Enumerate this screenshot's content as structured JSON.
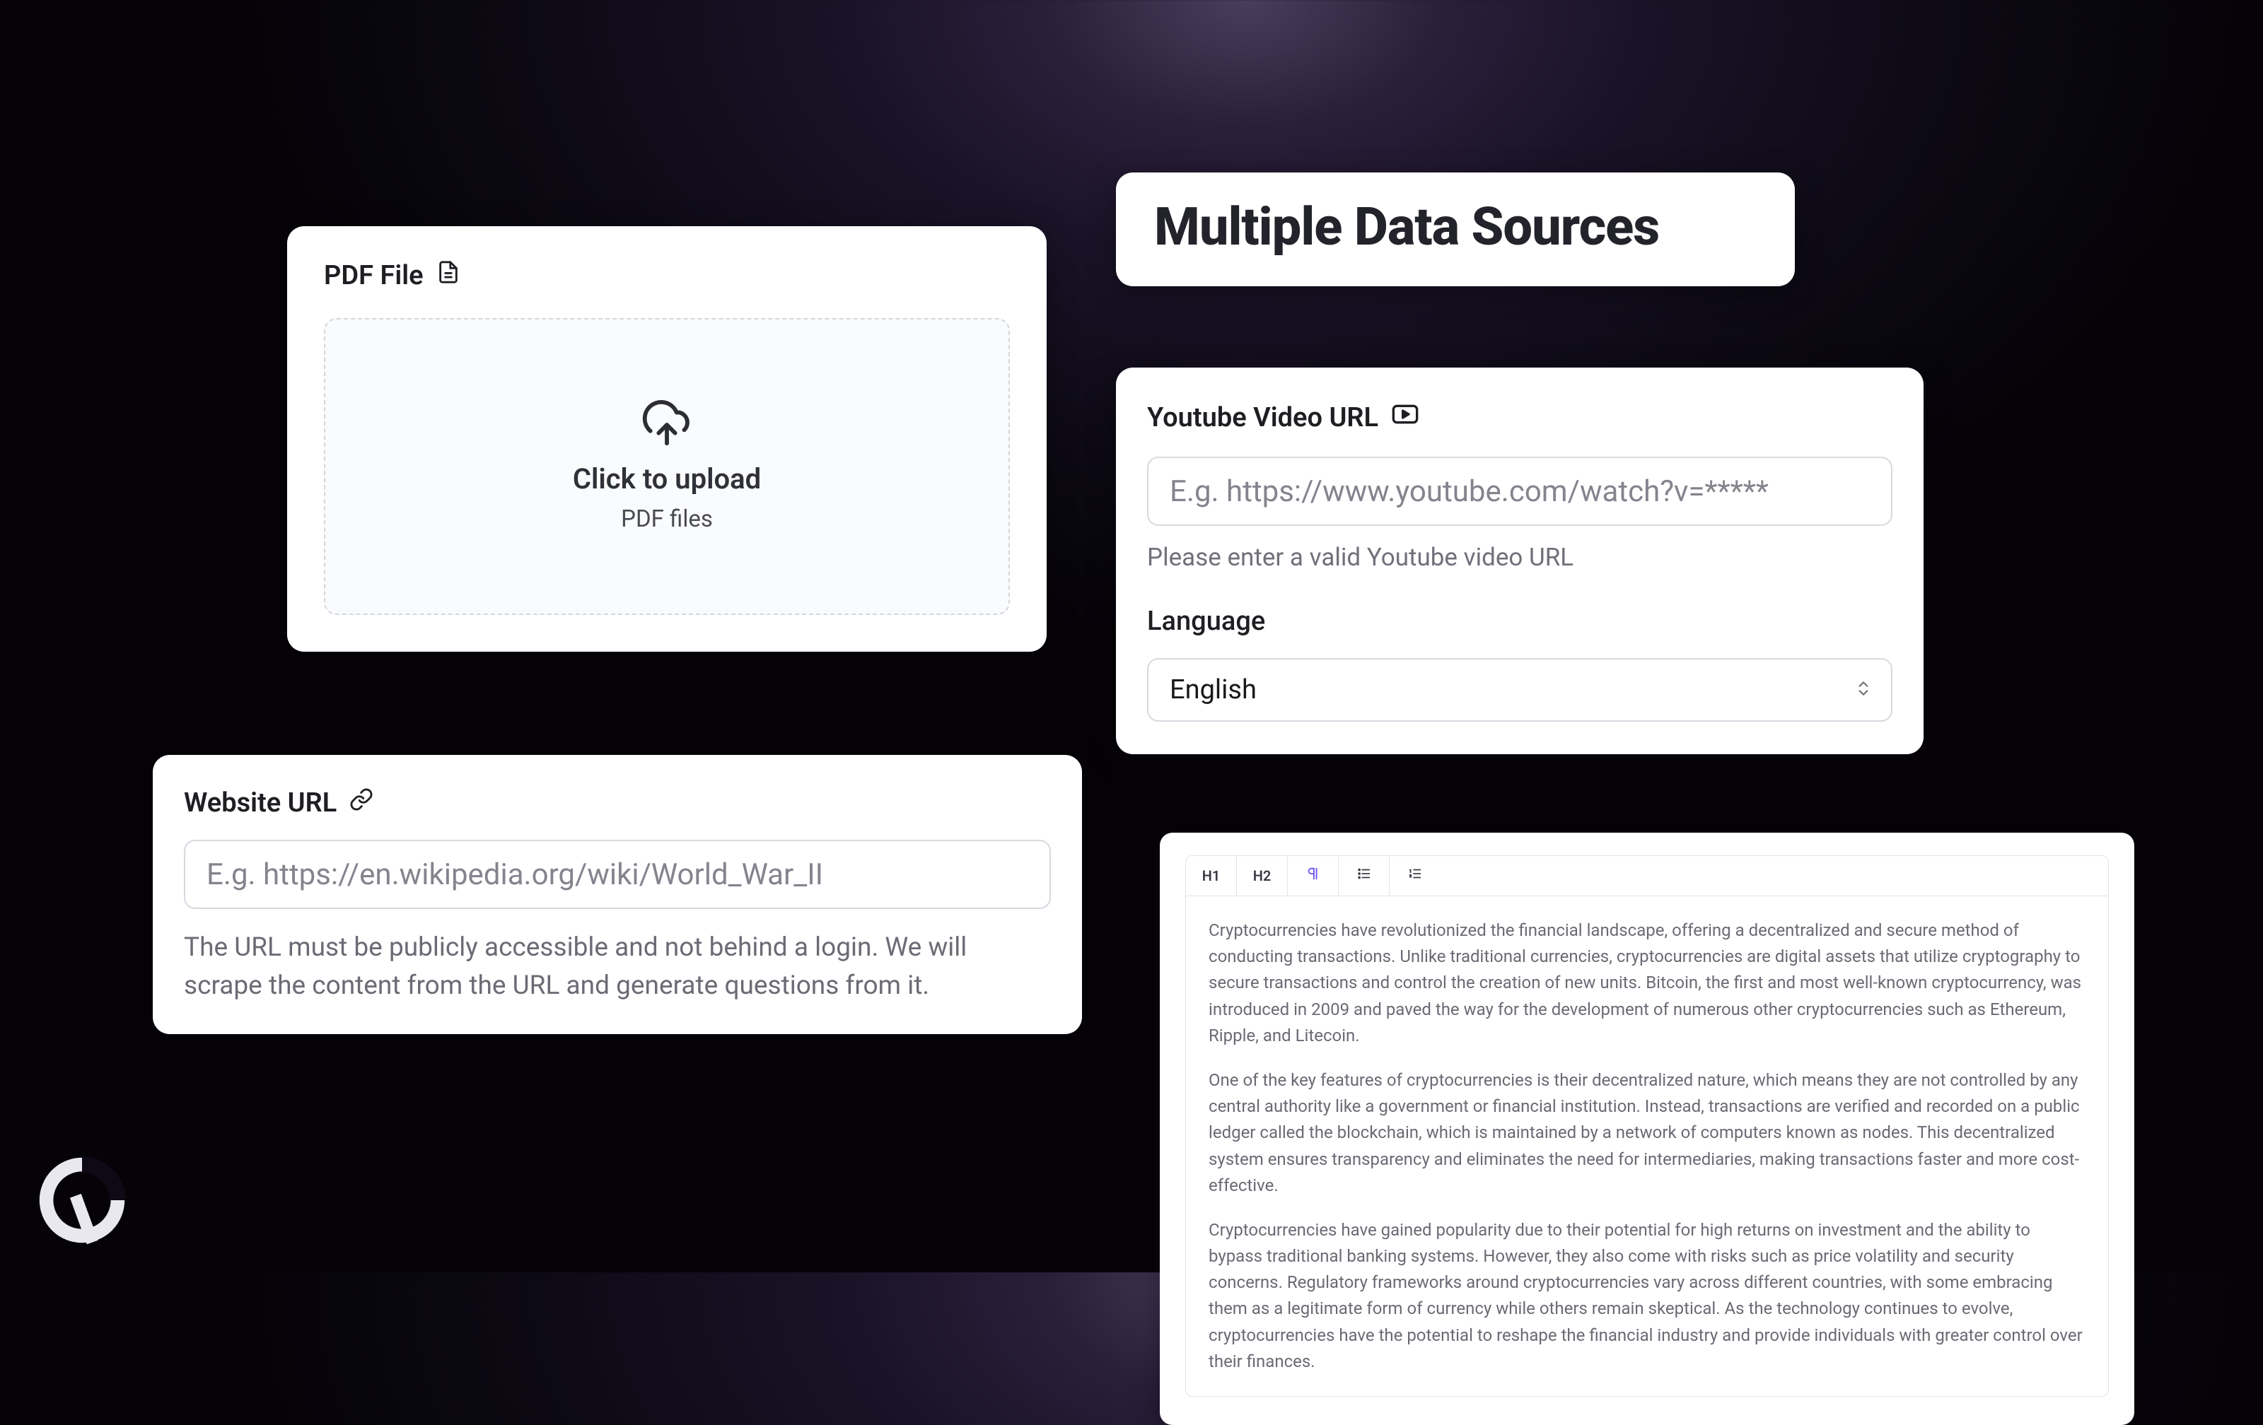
{
  "title": "Multiple Data Sources",
  "pdf": {
    "label": "PDF File",
    "drop_main": "Click to upload",
    "drop_sub": "PDF files"
  },
  "website": {
    "label": "Website URL",
    "placeholder": "E.g. https://en.wikipedia.org/wiki/World_War_II",
    "helper": "The URL must be publicly accessible and not behind a login. We will scrape the content from the URL and generate questions from it."
  },
  "youtube": {
    "label": "Youtube Video URL",
    "placeholder": "E.g. https://www.youtube.com/watch?v=*****",
    "helper": "Please enter a valid Youtube video URL",
    "lang_label": "Language",
    "lang_value": "English"
  },
  "editor": {
    "toolbar": {
      "h1": "H1",
      "h2": "H2"
    },
    "paragraphs": [
      "Cryptocurrencies have revolutionized the financial landscape, offering a decentralized and secure method of conducting transactions. Unlike traditional currencies, cryptocurrencies are digital assets that utilize cryptography to secure transactions and control the creation of new units. Bitcoin, the first and most well-known cryptocurrency, was introduced in 2009 and paved the way for the development of numerous other cryptocurrencies such as Ethereum, Ripple, and Litecoin.",
      "One of the key features of cryptocurrencies is their decentralized nature, which means they are not controlled by any central authority like a government or financial institution. Instead, transactions are verified and recorded on a public ledger called the blockchain, which is maintained by a network of computers known as nodes. This decentralized system ensures transparency and eliminates the need for intermediaries, making transactions faster and more cost-effective.",
      "Cryptocurrencies have gained popularity due to their potential for high returns on investment and the ability to bypass traditional banking systems. However, they also come with risks such as price volatility and security concerns. Regulatory frameworks around cryptocurrencies vary across different countries, with some embracing them as a legitimate form of currency while others remain skeptical. As the technology continues to evolve, cryptocurrencies have the potential to reshape the financial industry and provide individuals with greater control over their finances."
    ]
  }
}
